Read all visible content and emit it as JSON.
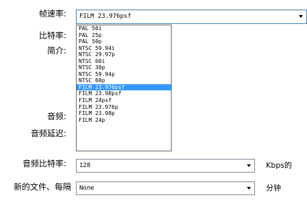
{
  "labels": {
    "frame_rate": "帧速率:",
    "bitrate": "比特率:",
    "profile": "简介:",
    "audio": "音频:",
    "audio_delay": "音频延迟:",
    "audio_bitrate": "音频比特率:",
    "new_file_every": "新的文件、每隔"
  },
  "frame_rate": {
    "value": "FILM 23.976psf"
  },
  "frame_rate_options": [
    "PAL 50i",
    "PAL 25p",
    "PAL 50p",
    "NTSC 59.94i",
    "NTSC 29.97p",
    "NTSC 60i",
    "NTSC 30p",
    "NTSC 59.94p",
    "NTSC 60p",
    "FILM 23.976psf",
    "FILM 23.98psf",
    "FILM 24psf",
    "FILM 23.976p",
    "FILM 23.98p",
    "FILM 24p"
  ],
  "selected_index": 9,
  "audio_bitrate": {
    "value": "128",
    "unit": "Kbps的"
  },
  "new_file": {
    "value": "None",
    "unit": "分钟"
  },
  "colors": {
    "highlight": "#3399ff"
  }
}
